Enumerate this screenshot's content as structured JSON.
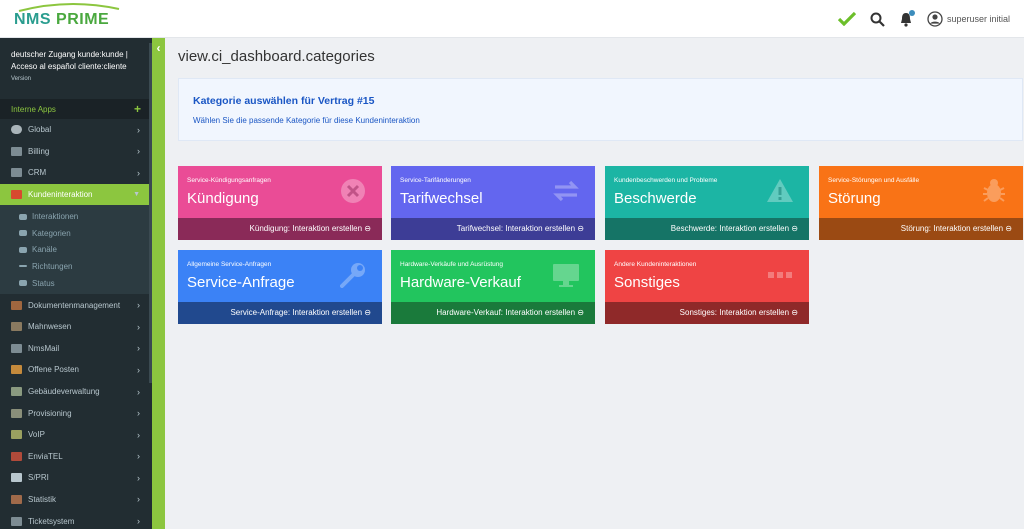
{
  "header": {
    "logo_text_1": "NMS",
    "logo_text_2": "PRIME",
    "user_name": "superuser initial"
  },
  "sidebar": {
    "user_panel": {
      "line1": "deutscher Zugang kunde:kunde |",
      "line2": "Acceso al español cliente:cliente",
      "version": "Version"
    },
    "section_label": "Interne Apps",
    "items_top": [
      {
        "label": "Global",
        "icon": "globe-icon"
      },
      {
        "label": "Billing",
        "icon": "billing-icon"
      },
      {
        "label": "CRM",
        "icon": "crm-icon"
      }
    ],
    "active_item": {
      "label": "Kundeninteraktion"
    },
    "subitems": [
      {
        "label": "Interaktionen"
      },
      {
        "label": "Kategorien"
      },
      {
        "label": "Kanäle"
      },
      {
        "label": "Richtungen"
      },
      {
        "label": "Status"
      }
    ],
    "items_bottom": [
      {
        "label": "Dokumentenmanagement"
      },
      {
        "label": "Mahnwesen"
      },
      {
        "label": "NmsMail"
      },
      {
        "label": "Offene Posten"
      },
      {
        "label": "Gebäudeverwaltung"
      },
      {
        "label": "Provisioning"
      },
      {
        "label": "VoIP"
      },
      {
        "label": "EnviaTEL"
      },
      {
        "label": "S/PRI"
      },
      {
        "label": "Statistik"
      },
      {
        "label": "Ticketsystem"
      }
    ]
  },
  "main": {
    "page_title": "view.ci_dashboard.categories",
    "callout": {
      "title": "Kategorie auswählen für Vertrag #15",
      "text": "Wählen Sie die passende Kategorie für diese Kundeninteraktion"
    },
    "boxes": [
      {
        "subtitle": "Service-Kündigungsanfragen",
        "title": "Kündigung",
        "footer": "Kündigung: Interaktion erstellen ⊖",
        "color": "#ea4c96",
        "footer_color": "#8a2a58",
        "icon": "times-circle-icon"
      },
      {
        "subtitle": "Service-Tarifänderungen",
        "title": "Tarifwechsel",
        "footer": "Tarifwechsel: Interaktion erstellen ⊖",
        "color": "#6366ef",
        "footer_color": "#3d3d96",
        "icon": "exchange-icon"
      },
      {
        "subtitle": "Kundenbeschwerden und Probleme",
        "title": "Beschwerde",
        "footer": "Beschwerde: Interaktion erstellen ⊖",
        "color": "#1cb5a4",
        "footer_color": "#157466",
        "icon": "warning-icon"
      },
      {
        "subtitle": "Service-Störungen und Ausfälle",
        "title": "Störung",
        "footer": "Störung: Interaktion erstellen ⊖",
        "color": "#f97316",
        "footer_color": "#9b4a13",
        "icon": "bug-icon"
      },
      {
        "subtitle": "Allgemeine Service-Anfragen",
        "title": "Service-Anfrage",
        "footer": "Service-Anfrage: Interaktion erstellen ⊖",
        "color": "#3b82f6",
        "footer_color": "#21498e",
        "icon": "wrench-icon"
      },
      {
        "subtitle": "Hardware-Verkäufe und Ausrüstung",
        "title": "Hardware-Verkauf",
        "footer": "Hardware-Verkauf: Interaktion erstellen ⊖",
        "color": "#22c55e",
        "footer_color": "#1a7a3b",
        "icon": "monitor-icon"
      },
      {
        "subtitle": "Andere Kundeninteraktionen",
        "title": "Sonstiges",
        "footer": "Sonstiges: Interaktion erstellen ⊖",
        "color": "#ef4444",
        "footer_color": "#8f2929",
        "icon": "ellipsis-icon"
      }
    ]
  }
}
